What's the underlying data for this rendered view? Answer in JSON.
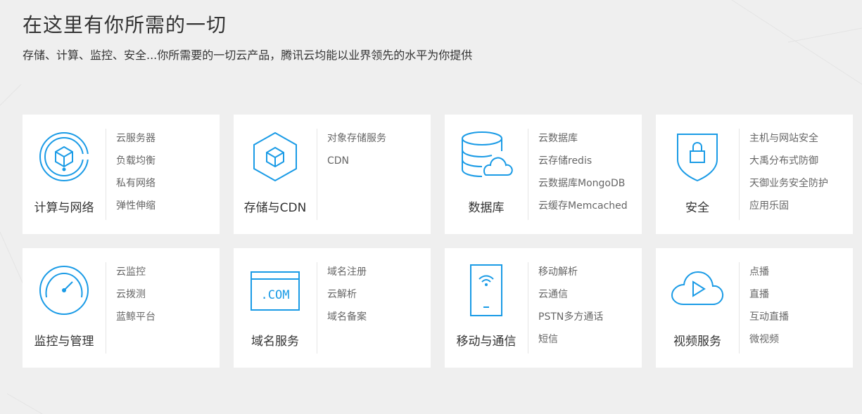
{
  "header": {
    "title": "在这里有你所需的一切",
    "subtitle": "存储、计算、监控、安全...你所需要的一切云产品，腾讯云均能以业界领先的水平为你提供"
  },
  "colors": {
    "accent": "#1a9be6",
    "card_bg": "#ffffff",
    "page_bg": "#efefef",
    "text": "#333333",
    "link_text": "#666666"
  },
  "cards": [
    {
      "title": "计算与网络",
      "icon": "cube-orbit-icon",
      "links": [
        "云服务器",
        "负载均衡",
        "私有网络",
        "弹性伸缩"
      ]
    },
    {
      "title": "存储与CDN",
      "icon": "hexagon-cube-icon",
      "links": [
        "对象存储服务",
        "CDN"
      ]
    },
    {
      "title": "数据库",
      "icon": "database-cloud-icon",
      "links": [
        "云数据库",
        "云存储redis",
        "云数据库MongoDB",
        "云缓存Memcached"
      ]
    },
    {
      "title": "安全",
      "icon": "shield-lock-icon",
      "links": [
        "主机与网站安全",
        "大禹分布式防御",
        "天御业务安全防护",
        "应用乐固"
      ]
    },
    {
      "title": "监控与管理",
      "icon": "gauge-icon",
      "links": [
        "云监控",
        "云拨测",
        "蓝鲸平台"
      ]
    },
    {
      "title": "域名服务",
      "icon": "browser-com-icon",
      "icon_text": ".COM",
      "links": [
        "域名注册",
        "云解析",
        "域名备案"
      ]
    },
    {
      "title": "移动与通信",
      "icon": "mobile-wifi-icon",
      "links": [
        "移动解析",
        "云通信",
        "PSTN多方通话",
        "短信"
      ]
    },
    {
      "title": "视频服务",
      "icon": "cloud-play-icon",
      "links": [
        "点播",
        "直播",
        "互动直播",
        "微视频"
      ]
    }
  ]
}
